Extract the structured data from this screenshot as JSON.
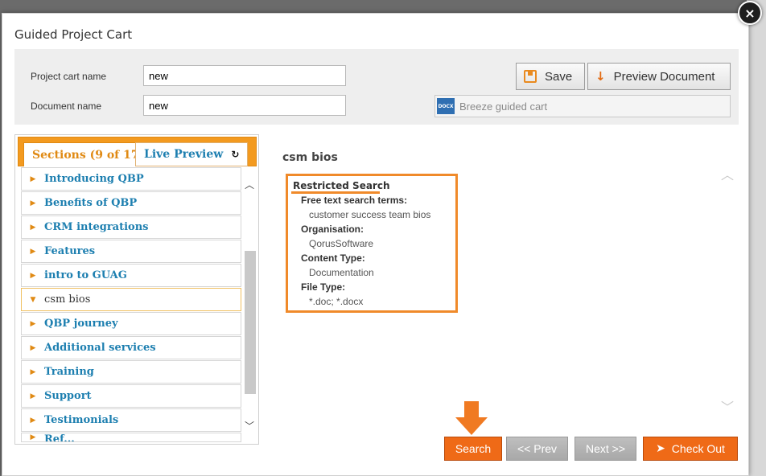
{
  "dialog": {
    "title": "Guided Project Cart",
    "close_label": "×"
  },
  "form": {
    "project_cart_label": "Project cart name",
    "project_cart_value": "new",
    "document_name_label": "Document name",
    "document_name_value": "new",
    "save_label": "Save",
    "preview_label": "Preview Document",
    "template_icon_text": "DOCX",
    "template_name": "Breeze guided cart"
  },
  "tabs": {
    "sections_label": "Sections (9 of 17)",
    "live_preview_label": "Live Preview"
  },
  "sections": [
    {
      "label": "Introducing QBP",
      "expanded": false
    },
    {
      "label": "Benefits of QBP",
      "expanded": false
    },
    {
      "label": "CRM integrations",
      "expanded": false
    },
    {
      "label": "Features",
      "expanded": false
    },
    {
      "label": "intro to GUAG",
      "expanded": false
    },
    {
      "label": "csm bios",
      "expanded": true
    },
    {
      "label": "QBP journey",
      "expanded": false
    },
    {
      "label": "Additional services",
      "expanded": false
    },
    {
      "label": "Training",
      "expanded": false
    },
    {
      "label": "Support",
      "expanded": false
    },
    {
      "label": "Testimonials",
      "expanded": false
    },
    {
      "label": "Ref...",
      "expanded": false
    }
  ],
  "content": {
    "section_title": "csm bios",
    "criteria_heading": "Restricted Search",
    "criteria": [
      {
        "key": "Free text search terms:",
        "value": "customer success team bios"
      },
      {
        "key": "Organisation:",
        "value": "QorusSoftware"
      },
      {
        "key": "Content Type:",
        "value": "Documentation"
      },
      {
        "key": "File Type:",
        "value": "*.doc; *.docx"
      }
    ]
  },
  "footer": {
    "search_label": "Search",
    "prev_label": "<< Prev",
    "next_label": "Next >>",
    "checkout_label": "Check Out"
  },
  "colors": {
    "accent_orange": "#ef6a17",
    "tab_orange": "#f39a1f",
    "link_blue": "#1d7fb0",
    "nav_gray": "#b3b3b3"
  }
}
